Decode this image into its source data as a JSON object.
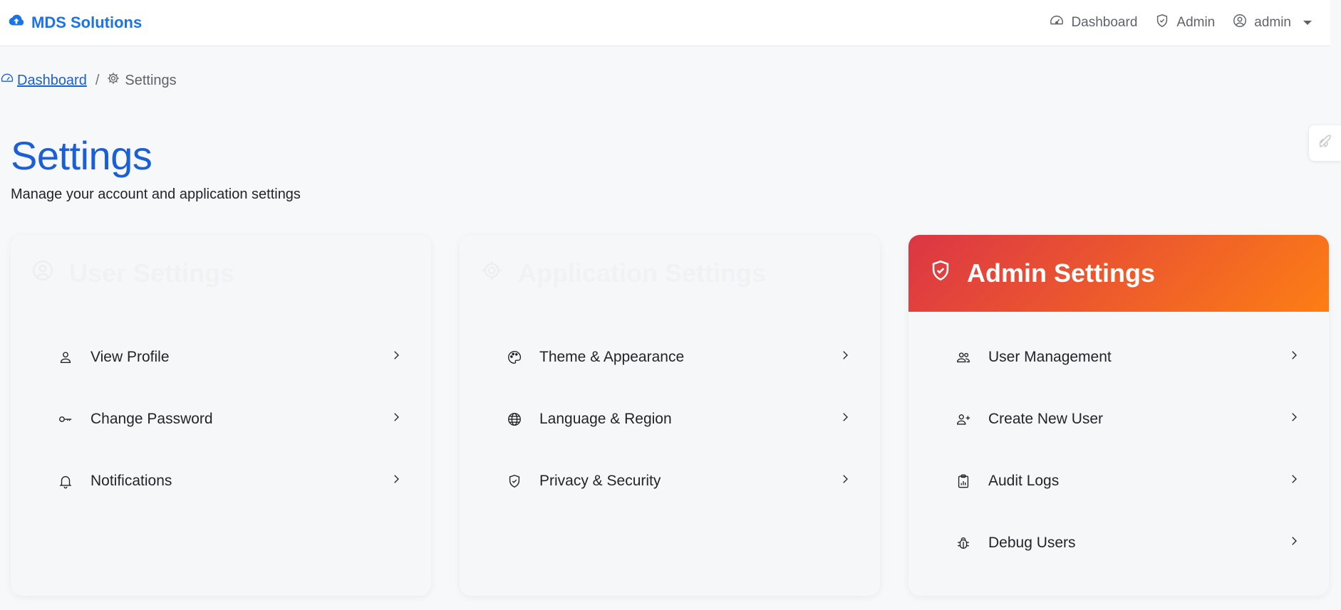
{
  "brand": {
    "name": "MDS Solutions"
  },
  "nav": {
    "dashboard": "Dashboard",
    "admin": "Admin",
    "user": "admin"
  },
  "breadcrumb": {
    "home": "Dashboard",
    "separator": "/",
    "current": "Settings"
  },
  "page": {
    "title": "Settings",
    "subtitle": "Manage your account and application settings"
  },
  "cards": [
    {
      "title": "User Settings",
      "icon": "user-circle-icon",
      "items": [
        {
          "label": "View Profile",
          "icon": "person-icon"
        },
        {
          "label": "Change Password",
          "icon": "key-icon"
        },
        {
          "label": "Notifications",
          "icon": "bell-icon"
        }
      ]
    },
    {
      "title": "Application Settings",
      "icon": "gear-icon",
      "items": [
        {
          "label": "Theme & Appearance",
          "icon": "palette-icon"
        },
        {
          "label": "Language & Region",
          "icon": "globe-icon"
        },
        {
          "label": "Privacy & Security",
          "icon": "shield-check-icon"
        }
      ]
    },
    {
      "title": "Admin Settings",
      "icon": "shield-check-icon",
      "items": [
        {
          "label": "User Management",
          "icon": "people-icon"
        },
        {
          "label": "Create New User",
          "icon": "person-plus-icon"
        },
        {
          "label": "Audit Logs",
          "icon": "clipboard-data-icon"
        },
        {
          "label": "Debug Users",
          "icon": "bug-icon"
        }
      ]
    }
  ],
  "colors": {
    "brand": "#1a73e8",
    "title": "#1a5fd6",
    "admin_gradient_start": "#dc3545",
    "admin_gradient_end": "#fd7e14",
    "background": "#f7f8fa"
  }
}
